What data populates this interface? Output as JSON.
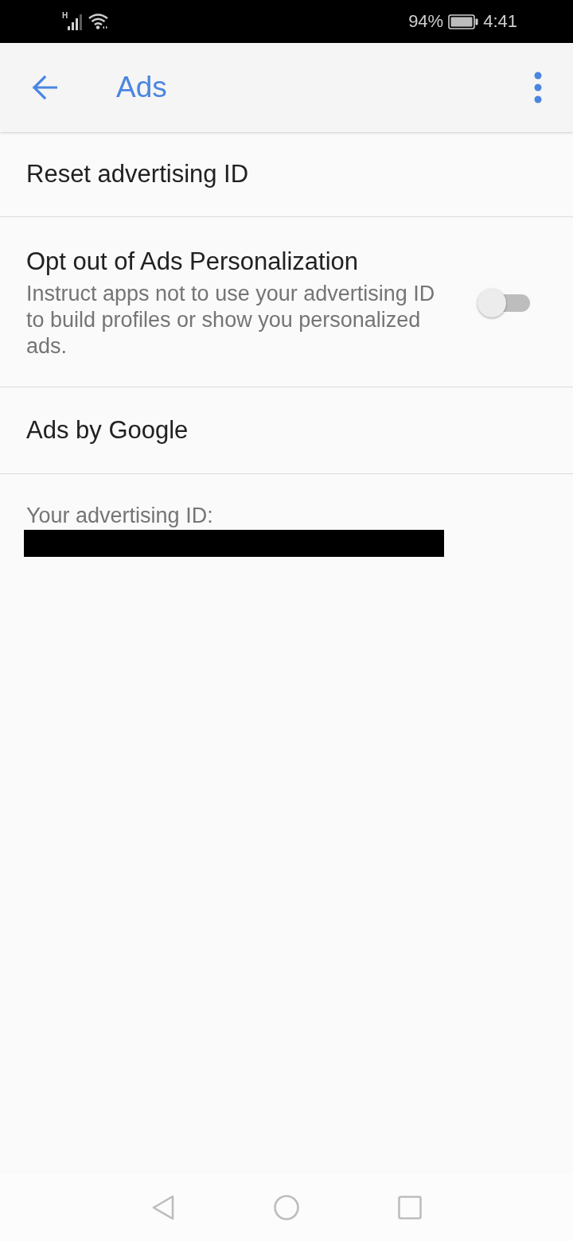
{
  "status_bar": {
    "network_type": "H",
    "battery": "94%",
    "time": "4:41"
  },
  "app_bar": {
    "title": "Ads"
  },
  "settings": [
    {
      "kind": "action",
      "title": "Reset advertising ID"
    },
    {
      "kind": "switch",
      "title": "Opt out of Ads Personalization",
      "summary": "Instruct apps not to use your advertising ID to build profiles or show you personalized ads.",
      "on": false
    },
    {
      "kind": "action",
      "title": "Ads by Google"
    }
  ],
  "advertising_id": {
    "label": "Your advertising ID:"
  }
}
